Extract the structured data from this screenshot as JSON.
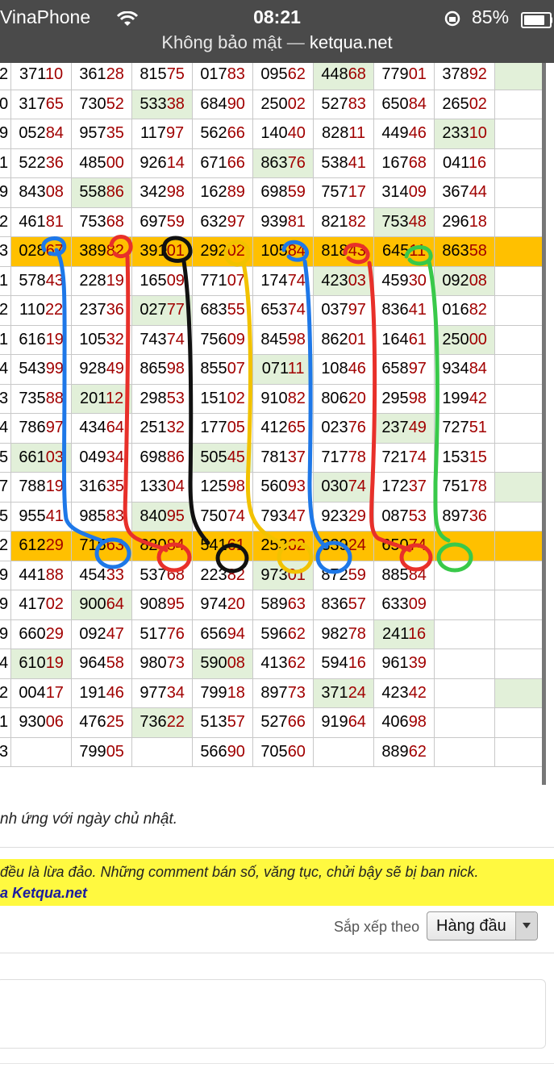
{
  "status": {
    "carrier": "VinaPhone",
    "time": "08:21",
    "battery": "85%"
  },
  "browser": {
    "security_label": "Không bảo mật",
    "separator": "—",
    "domain": "ketqua.net"
  },
  "table": {
    "highlight_rows": [
      6,
      16
    ],
    "rows": [
      {
        "edge": "2",
        "cells": [
          [
            "371",
            "10"
          ],
          [
            "361",
            "28"
          ],
          [
            "815",
            "75"
          ],
          [
            "017",
            "83"
          ],
          [
            "095",
            "62"
          ],
          [
            "448",
            "68"
          ],
          [
            "779",
            "01"
          ],
          [
            "378",
            "92"
          ],
          [
            "",
            ""
          ]
        ],
        "green": [
          5,
          8
        ]
      },
      {
        "edge": "0",
        "cells": [
          [
            "317",
            "65"
          ],
          [
            "730",
            "52"
          ],
          [
            "533",
            "38"
          ],
          [
            "684",
            "90"
          ],
          [
            "250",
            "02"
          ],
          [
            "527",
            "83"
          ],
          [
            "650",
            "84"
          ],
          [
            "265",
            "02"
          ],
          [
            "",
            ""
          ]
        ],
        "green": [
          2
        ]
      },
      {
        "edge": "9",
        "cells": [
          [
            "052",
            "84"
          ],
          [
            "957",
            "35"
          ],
          [
            "117",
            "97"
          ],
          [
            "562",
            "66"
          ],
          [
            "140",
            "40"
          ],
          [
            "828",
            "11"
          ],
          [
            "449",
            "46"
          ],
          [
            "233",
            "10"
          ],
          [
            "",
            ""
          ]
        ],
        "green": [
          7
        ]
      },
      {
        "edge": "1",
        "cells": [
          [
            "522",
            "36"
          ],
          [
            "485",
            "00"
          ],
          [
            "926",
            "14"
          ],
          [
            "671",
            "66"
          ],
          [
            "863",
            "76"
          ],
          [
            "538",
            "41"
          ],
          [
            "167",
            "68"
          ],
          [
            "041",
            "16"
          ],
          [
            "",
            ""
          ]
        ],
        "green": [
          4
        ]
      },
      {
        "edge": "9",
        "cells": [
          [
            "843",
            "08"
          ],
          [
            "558",
            "86"
          ],
          [
            "342",
            "98"
          ],
          [
            "162",
            "89"
          ],
          [
            "698",
            "59"
          ],
          [
            "757",
            "17"
          ],
          [
            "314",
            "09"
          ],
          [
            "367",
            "44"
          ],
          [
            "",
            ""
          ]
        ],
        "green": [
          1
        ]
      },
      {
        "edge": "2",
        "cells": [
          [
            "461",
            "81"
          ],
          [
            "753",
            "68"
          ],
          [
            "697",
            "59"
          ],
          [
            "632",
            "97"
          ],
          [
            "939",
            "81"
          ],
          [
            "821",
            "82"
          ],
          [
            "753",
            "48"
          ],
          [
            "296",
            "18"
          ],
          [
            "",
            ""
          ]
        ],
        "green": [
          6
        ]
      },
      {
        "edge": "3",
        "cells": [
          [
            "028",
            "67"
          ],
          [
            "389",
            "82"
          ],
          [
            "391",
            "01"
          ],
          [
            "292",
            "02"
          ],
          [
            "105",
            "84"
          ],
          [
            "818",
            "43"
          ],
          [
            "645",
            "11"
          ],
          [
            "863",
            "58"
          ],
          [
            "",
            ""
          ]
        ],
        "green": []
      },
      {
        "edge": "1",
        "cells": [
          [
            "578",
            "43"
          ],
          [
            "228",
            "19"
          ],
          [
            "165",
            "09"
          ],
          [
            "771",
            "07"
          ],
          [
            "174",
            "74"
          ],
          [
            "423",
            "03"
          ],
          [
            "459",
            "30"
          ],
          [
            "092",
            "08"
          ],
          [
            "",
            ""
          ]
        ],
        "green": [
          5,
          7
        ]
      },
      {
        "edge": "2",
        "cells": [
          [
            "110",
            "22"
          ],
          [
            "237",
            "36"
          ],
          [
            "027",
            "77"
          ],
          [
            "683",
            "55"
          ],
          [
            "653",
            "74"
          ],
          [
            "037",
            "97"
          ],
          [
            "836",
            "41"
          ],
          [
            "016",
            "82"
          ],
          [
            "",
            ""
          ]
        ],
        "green": [
          2
        ]
      },
      {
        "edge": "1",
        "cells": [
          [
            "616",
            "19"
          ],
          [
            "105",
            "32"
          ],
          [
            "743",
            "74"
          ],
          [
            "756",
            "09"
          ],
          [
            "845",
            "98"
          ],
          [
            "862",
            "01"
          ],
          [
            "164",
            "61"
          ],
          [
            "250",
            "00"
          ],
          [
            "",
            ""
          ]
        ],
        "green": [
          7
        ]
      },
      {
        "edge": "4",
        "cells": [
          [
            "543",
            "99"
          ],
          [
            "928",
            "49"
          ],
          [
            "865",
            "98"
          ],
          [
            "855",
            "07"
          ],
          [
            "071",
            "11"
          ],
          [
            "108",
            "46"
          ],
          [
            "658",
            "97"
          ],
          [
            "934",
            "84"
          ],
          [
            "",
            ""
          ]
        ],
        "green": [
          4
        ]
      },
      {
        "edge": "3",
        "cells": [
          [
            "735",
            "88"
          ],
          [
            "201",
            "12"
          ],
          [
            "298",
            "53"
          ],
          [
            "151",
            "02"
          ],
          [
            "910",
            "82"
          ],
          [
            "806",
            "20"
          ],
          [
            "295",
            "98"
          ],
          [
            "199",
            "42"
          ],
          [
            "",
            ""
          ]
        ],
        "green": [
          1
        ]
      },
      {
        "edge": "4",
        "cells": [
          [
            "786",
            "97"
          ],
          [
            "434",
            "64"
          ],
          [
            "251",
            "32"
          ],
          [
            "177",
            "05"
          ],
          [
            "412",
            "65"
          ],
          [
            "023",
            "76"
          ],
          [
            "237",
            "49"
          ],
          [
            "727",
            "51"
          ],
          [
            "",
            ""
          ]
        ],
        "green": [
          6
        ]
      },
      {
        "edge": "5",
        "cells": [
          [
            "661",
            "03"
          ],
          [
            "049",
            "34"
          ],
          [
            "698",
            "86"
          ],
          [
            "505",
            "45"
          ],
          [
            "781",
            "37"
          ],
          [
            "717",
            "78"
          ],
          [
            "721",
            "74"
          ],
          [
            "153",
            "15"
          ],
          [
            "",
            ""
          ]
        ],
        "green": [
          0,
          3
        ]
      },
      {
        "edge": "7",
        "cells": [
          [
            "788",
            "19"
          ],
          [
            "316",
            "35"
          ],
          [
            "133",
            "04"
          ],
          [
            "125",
            "98"
          ],
          [
            "560",
            "93"
          ],
          [
            "030",
            "74"
          ],
          [
            "172",
            "37"
          ],
          [
            "751",
            "78"
          ],
          [
            "",
            ""
          ]
        ],
        "green": [
          5,
          8
        ]
      },
      {
        "edge": "5",
        "cells": [
          [
            "955",
            "41"
          ],
          [
            "985",
            "83"
          ],
          [
            "840",
            "95"
          ],
          [
            "750",
            "74"
          ],
          [
            "793",
            "47"
          ],
          [
            "923",
            "29"
          ],
          [
            "087",
            "53"
          ],
          [
            "897",
            "36"
          ],
          [
            "",
            ""
          ]
        ],
        "green": [
          2
        ]
      },
      {
        "edge": "2",
        "cells": [
          [
            "612",
            "29"
          ],
          [
            "715",
            "63"
          ],
          [
            "820",
            "84"
          ],
          [
            "541",
            "61"
          ],
          [
            "253",
            "62"
          ],
          [
            "339",
            "24"
          ],
          [
            "650",
            "74"
          ],
          [
            "",
            ""
          ],
          [
            "",
            ""
          ]
        ],
        "green": []
      },
      {
        "edge": "9",
        "cells": [
          [
            "441",
            "88"
          ],
          [
            "454",
            "33"
          ],
          [
            "537",
            "68"
          ],
          [
            "223",
            "82"
          ],
          [
            "973",
            "01"
          ],
          [
            "872",
            "59"
          ],
          [
            "885",
            "84"
          ],
          [
            "",
            ""
          ],
          [
            "",
            ""
          ]
        ],
        "green": [
          4
        ]
      },
      {
        "edge": "9",
        "cells": [
          [
            "417",
            "02"
          ],
          [
            "900",
            "64"
          ],
          [
            "908",
            "95"
          ],
          [
            "974",
            "20"
          ],
          [
            "589",
            "63"
          ],
          [
            "836",
            "57"
          ],
          [
            "633",
            "09"
          ],
          [
            "",
            ""
          ],
          [
            "",
            ""
          ]
        ],
        "green": [
          1
        ]
      },
      {
        "edge": "9",
        "cells": [
          [
            "660",
            "29"
          ],
          [
            "092",
            "47"
          ],
          [
            "517",
            "76"
          ],
          [
            "656",
            "94"
          ],
          [
            "596",
            "62"
          ],
          [
            "982",
            "78"
          ],
          [
            "241",
            "16"
          ],
          [
            "",
            ""
          ],
          [
            "",
            ""
          ]
        ],
        "green": [
          6
        ]
      },
      {
        "edge": "4",
        "cells": [
          [
            "610",
            "19"
          ],
          [
            "964",
            "58"
          ],
          [
            "980",
            "73"
          ],
          [
            "590",
            "08"
          ],
          [
            "413",
            "62"
          ],
          [
            "594",
            "16"
          ],
          [
            "961",
            "39"
          ],
          [
            "",
            ""
          ],
          [
            "",
            ""
          ]
        ],
        "green": [
          0,
          3
        ]
      },
      {
        "edge": "2",
        "cells": [
          [
            "004",
            "17"
          ],
          [
            "191",
            "46"
          ],
          [
            "977",
            "34"
          ],
          [
            "799",
            "18"
          ],
          [
            "897",
            "73"
          ],
          [
            "371",
            "24"
          ],
          [
            "423",
            "42"
          ],
          [
            "",
            ""
          ],
          [
            "",
            ""
          ]
        ],
        "green": [
          5,
          8
        ]
      },
      {
        "edge": "1",
        "cells": [
          [
            "930",
            "06"
          ],
          [
            "476",
            "25"
          ],
          [
            "736",
            "22"
          ],
          [
            "513",
            "57"
          ],
          [
            "527",
            "66"
          ],
          [
            "919",
            "64"
          ],
          [
            "406",
            "98"
          ],
          [
            "",
            ""
          ],
          [
            "",
            ""
          ]
        ],
        "green": [
          2
        ]
      },
      {
        "edge": "3",
        "cells": [
          [
            "",
            ""
          ],
          [
            "799",
            "05"
          ],
          [
            "",
            ""
          ],
          [
            "566",
            "90"
          ],
          [
            "705",
            "60"
          ],
          [
            "",
            ""
          ],
          [
            "889",
            "62"
          ],
          [
            "",
            ""
          ],
          [
            "",
            ""
          ]
        ],
        "green": []
      }
    ]
  },
  "caption": "nh ứng với ngày chủ nhật.",
  "notice": {
    "line1": " đều là lừa đảo. Những comment bán số, văng tục, chửi bậy sẽ bị ban nick.",
    "line2": "a Ketqua.net"
  },
  "sort": {
    "label": "Sắp xếp theo",
    "value": "Hàng đầu"
  },
  "colors": {
    "status_bar": "#4a4a4a",
    "highlight": "#ffc000",
    "green_cell": "#e2f0d9",
    "notice_bg": "#fff940",
    "digit_red": "#a10000"
  }
}
